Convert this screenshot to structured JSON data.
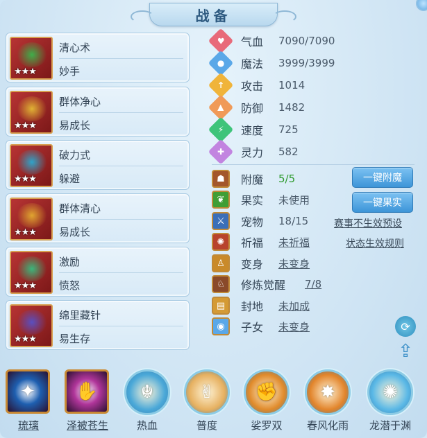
{
  "window": {
    "title": "战备"
  },
  "skills": [
    {
      "name": "清心术",
      "sub": "妙手",
      "stars": "★★★",
      "icon": "green-sword-icon",
      "art_color": "#3fae4a"
    },
    {
      "name": "群体净心",
      "sub": "易成长",
      "stars": "★★★",
      "icon": "golden-armor-icon",
      "art_color": "#e0b234"
    },
    {
      "name": "破力式",
      "sub": "躲避",
      "stars": "★★★",
      "icon": "warrior-icon",
      "art_color": "#2fa3c9"
    },
    {
      "name": "群体清心",
      "sub": "易成长",
      "stars": "★★★",
      "icon": "golden-dragon-icon",
      "art_color": "#e0a530"
    },
    {
      "name": "激励",
      "sub": "愤怒",
      "stars": "★★★",
      "icon": "cauldron-icon",
      "art_color": "#3bb67b"
    },
    {
      "name": "绵里藏针",
      "sub": "易生存",
      "stars": "★★★",
      "icon": "purple-robe-icon",
      "art_color": "#5a4fc0"
    }
  ],
  "stats": [
    {
      "label": "气血",
      "value": "7090/7090",
      "icon": "heart-icon",
      "color": "#e86a7a"
    },
    {
      "label": "魔法",
      "value": "3999/3999",
      "icon": "mana-icon",
      "color": "#5aa8e8"
    },
    {
      "label": "攻击",
      "value": "1014",
      "icon": "sword-icon",
      "color": "#f0b43a"
    },
    {
      "label": "防御",
      "value": "1482",
      "icon": "shield-icon",
      "color": "#f09a58"
    },
    {
      "label": "速度",
      "value": "725",
      "icon": "lightning-icon",
      "color": "#3ec47a"
    },
    {
      "label": "灵力",
      "value": "582",
      "icon": "spirit-icon",
      "color": "#c284e0"
    }
  ],
  "props": [
    {
      "label": "附魔",
      "value": "5/5",
      "icon": "enchant-icon",
      "bg": "#a3572b",
      "style": "green"
    },
    {
      "label": "果实",
      "value": "未使用",
      "icon": "fruit-icon",
      "bg": "#3f9e34",
      "style": ""
    },
    {
      "label": "宠物",
      "value": "18/15",
      "icon": "pet-icon",
      "bg": "#3a6fb8",
      "style": ""
    },
    {
      "label": "祈福",
      "value": "未祈福",
      "icon": "blessing-icon",
      "bg": "#b8432c",
      "style": "link"
    },
    {
      "label": "变身",
      "value": "未变身",
      "icon": "transform-icon",
      "bg": "#c98a2a",
      "style": "link"
    },
    {
      "label": "修炼觉醒",
      "value": "7/8",
      "icon": "cultivation-icon",
      "bg": "#8a4a2a",
      "style": "link"
    },
    {
      "label": "封地",
      "value": "未加成",
      "icon": "fief-icon",
      "bg": "#d49a35",
      "style": "link"
    },
    {
      "label": "子女",
      "value": "未变身",
      "icon": "child-icon",
      "bg": "#5aa8e8",
      "style": "link"
    }
  ],
  "buttons": {
    "enchant": "一键附魔",
    "fruit": "一键果实"
  },
  "links": {
    "event_preset": "赛事不生效预设",
    "status_rules": "状态生效规则"
  },
  "side_icons": {
    "refresh": "refresh-icon",
    "share": "share-icon"
  },
  "bottom_skills": [
    {
      "label": "琉璃",
      "icon": "crystal-icon",
      "shape": "sq",
      "bg": "#1e5fb0",
      "glyph": "✦",
      "underline": true
    },
    {
      "label": "泽被苍生",
      "icon": "palm-icon",
      "shape": "sq",
      "bg": "#b0359a",
      "glyph": "✋",
      "underline": true
    },
    {
      "label": "热血",
      "icon": "fighter-icon",
      "shape": "orb",
      "bg": "#4aa8d8",
      "glyph": "☬",
      "underline": false
    },
    {
      "label": "普度",
      "icon": "hand-icon",
      "shape": "orb",
      "bg": "#e6b060",
      "glyph": "✌",
      "underline": false
    },
    {
      "label": "娑罗双",
      "icon": "fist-icon",
      "shape": "orb",
      "bg": "#e08a2a",
      "glyph": "✊",
      "underline": false
    },
    {
      "label": "春风化雨",
      "icon": "blaze-icon",
      "shape": "orb",
      "bg": "#e2842a",
      "glyph": "✸",
      "underline": false
    },
    {
      "label": "龙潜于渊",
      "icon": "dragon-icon",
      "shape": "orb",
      "bg": "#5ab8e6",
      "glyph": "✺",
      "underline": false
    }
  ]
}
